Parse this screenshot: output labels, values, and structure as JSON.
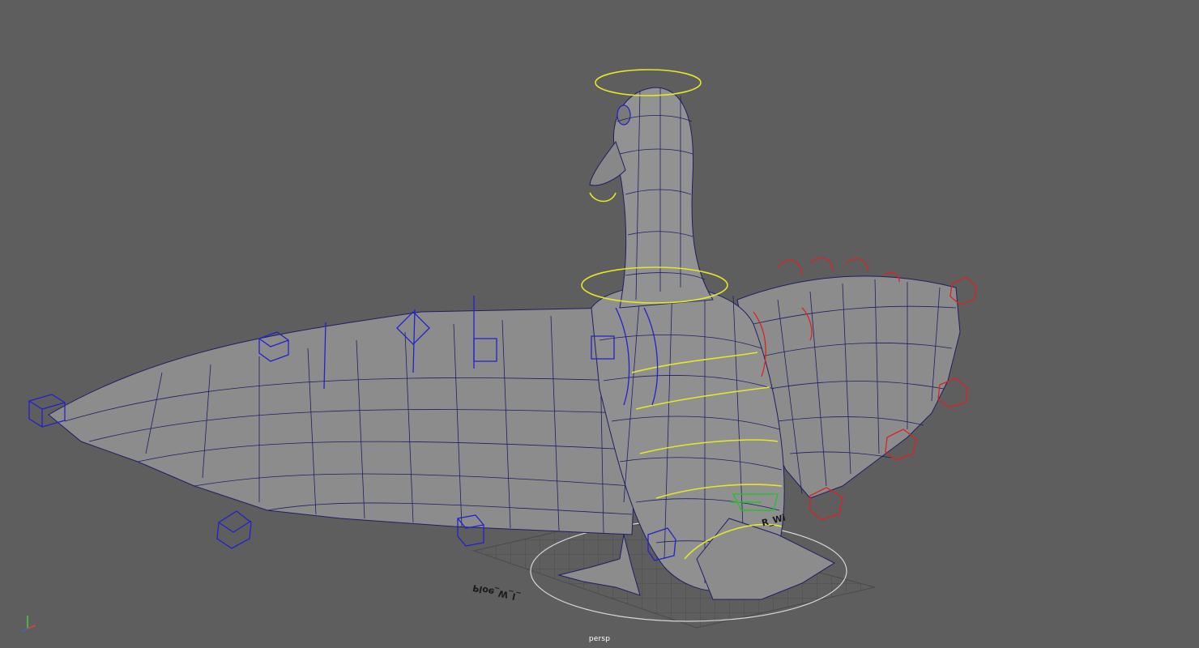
{
  "viewport": {
    "camera": "persp",
    "background": "#5e5e5e",
    "mesh_fill": "#8a8a8a",
    "wire_color": "#1e1e66",
    "ctrl_left_color": "#2222cc",
    "ctrl_right_color": "#dd2222",
    "ctrl_spine_color": "#e6e62a",
    "ctrl_foot_color": "#28c028"
  },
  "grid_labels": {
    "left": "Ploe_W_l_",
    "right": "R_Wi"
  },
  "axis": {
    "x_color": "#e04040",
    "y_color": "#40d040",
    "z_color": "#4060e0"
  }
}
